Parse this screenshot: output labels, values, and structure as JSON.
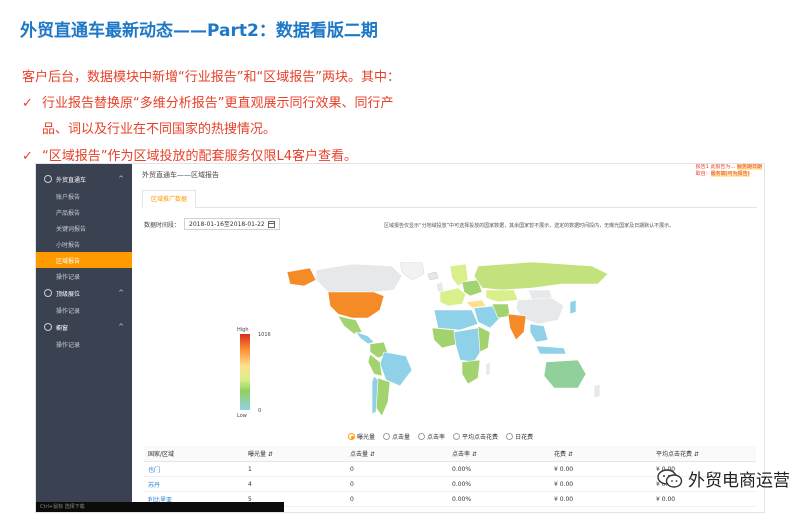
{
  "slide": {
    "title": "外贸直通车最新动态——Part2：数据看版二期",
    "intro": "客户后台，数据模块中新增“行业报告”和“区域报告”两块。其中：",
    "bullets": [
      {
        "check": "✓",
        "text": "行业报告替换原“多维分析报告”更直观展示同行效果、同行产"
      },
      {
        "check": "",
        "text": "品、词以及行业在不同国家的热搜情况。"
      },
      {
        "check": "✓",
        "text": "“区域报告”作为区域投放的配套服务仅限L4客户查看。"
      }
    ]
  },
  "sidebar": {
    "group1": {
      "label": "外贸直通车",
      "chevron": "^"
    },
    "items1": [
      {
        "label": "账户报告"
      },
      {
        "label": "产品报告"
      },
      {
        "label": "关键词报告"
      },
      {
        "label": "小时报告"
      },
      {
        "label": "区域报告",
        "active": true
      },
      {
        "label": "操作记录"
      }
    ],
    "group2": {
      "label": "顶级展位",
      "chevron": "^"
    },
    "items2": [
      {
        "label": "操作记录"
      }
    ],
    "group3": {
      "label": "橱窗",
      "chevron": "^"
    },
    "items3": [
      {
        "label": "操作记录"
      }
    ],
    "footer": "Ctrl+鼠标 选择下载"
  },
  "main": {
    "breadcrumb": "外贸直通车——区域报告",
    "top_note_line1": "报告1 此报告为…  ",
    "top_note_hl1": "服务期日期",
    "top_note_line2": "取自：",
    "top_note_hl2": "服务端(可为报告)",
    "tab": "区域推广数据",
    "date_label": "数据时间段：",
    "date_value": "2018-01-16至2018-01-22",
    "region_note": "区域报告仅显示“分地域投放”中可选择投放的国家数据，其余国家暂不展示，选定的数据时间段内，无曝光国家及日期默认不展示。",
    "legend_high": "High",
    "legend_low": "Low",
    "legend_max": "1016",
    "legend_min": "0"
  },
  "metrics": [
    {
      "label": "曝光量",
      "selected": true
    },
    {
      "label": "点击量",
      "selected": false
    },
    {
      "label": "点击率",
      "selected": false
    },
    {
      "label": "平均点击花费",
      "selected": false
    },
    {
      "label": "日花费",
      "selected": false
    }
  ],
  "table": {
    "headers": [
      "国家/区域",
      "曝光量 ⇵",
      "点击量 ⇵",
      "点击率 ⇵",
      "花费 ⇵",
      "平均点击花费 ⇵"
    ],
    "rows": [
      [
        "也门",
        "1",
        "0",
        "0.00%",
        "¥ 0.00",
        "¥ 0.00"
      ],
      [
        "苏丹",
        "4",
        "0",
        "0.00%",
        "¥ 0.00",
        "¥ 0.00"
      ],
      [
        "利比里亚",
        "5",
        "0",
        "0.00%",
        "¥ 0.00",
        "¥ 0.00"
      ]
    ]
  },
  "watermark": {
    "text": "外贸电商运营",
    "icon": "wechat-icon"
  },
  "colors": {
    "accent": "#ff9a00",
    "title_blue": "#1e78c8",
    "red": "#e8402a",
    "sidebar_bg": "#3a4150"
  }
}
